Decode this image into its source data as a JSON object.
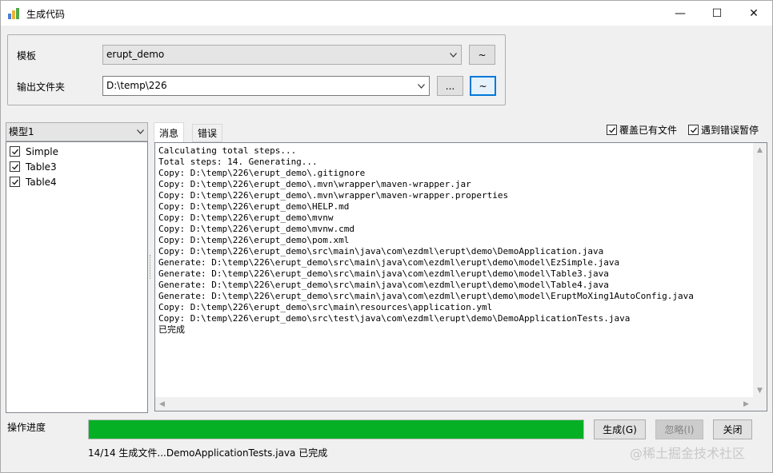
{
  "window": {
    "title": "生成代码",
    "min_glyph": "—",
    "max_glyph": "☐",
    "close_glyph": "✕"
  },
  "settings": {
    "template_label": "模板",
    "template_value": "erupt_demo",
    "template_btn": "~",
    "output_label": "输出文件夹",
    "output_value": "D:\\temp\\226",
    "browse_btn": "...",
    "output_btn": "~"
  },
  "model": {
    "selected": "模型1",
    "items": [
      {
        "label": "Simple",
        "checked": true
      },
      {
        "label": "Table3",
        "checked": true
      },
      {
        "label": "Table4",
        "checked": true
      }
    ]
  },
  "tabs": [
    {
      "label": "消息",
      "active": true
    },
    {
      "label": "错误",
      "active": false
    }
  ],
  "options": {
    "overwrite_label": "覆盖已有文件",
    "overwrite_checked": true,
    "pause_on_error_label": "遇到错误暂停",
    "pause_on_error_checked": true
  },
  "log": {
    "lines": [
      "Calculating total steps...",
      "Total steps: 14. Generating...",
      "Copy: D:\\temp\\226\\erupt_demo\\.gitignore",
      "Copy: D:\\temp\\226\\erupt_demo\\.mvn\\wrapper\\maven-wrapper.jar",
      "Copy: D:\\temp\\226\\erupt_demo\\.mvn\\wrapper\\maven-wrapper.properties",
      "Copy: D:\\temp\\226\\erupt_demo\\HELP.md",
      "Copy: D:\\temp\\226\\erupt_demo\\mvnw",
      "Copy: D:\\temp\\226\\erupt_demo\\mvnw.cmd",
      "Copy: D:\\temp\\226\\erupt_demo\\pom.xml",
      "Copy: D:\\temp\\226\\erupt_demo\\src\\main\\java\\com\\ezdml\\erupt\\demo\\DemoApplication.java",
      "Generate: D:\\temp\\226\\erupt_demo\\src\\main\\java\\com\\ezdml\\erupt\\demo\\model\\EzSimple.java",
      "Generate: D:\\temp\\226\\erupt_demo\\src\\main\\java\\com\\ezdml\\erupt\\demo\\model\\Table3.java",
      "Generate: D:\\temp\\226\\erupt_demo\\src\\main\\java\\com\\ezdml\\erupt\\demo\\model\\Table4.java",
      "Generate: D:\\temp\\226\\erupt_demo\\src\\main\\java\\com\\ezdml\\erupt\\demo\\model\\EruptMoXing1AutoConfig.java",
      "Copy: D:\\temp\\226\\erupt_demo\\src\\main\\resources\\application.yml",
      "Copy: D:\\temp\\226\\erupt_demo\\src\\test\\java\\com\\ezdml\\erupt\\demo\\DemoApplicationTests.java",
      "已完成"
    ]
  },
  "progress": {
    "label": "操作进度",
    "fraction": 1.0,
    "fill_color": "#06b025",
    "status_text": "14/14 生成文件...DemoApplicationTests.java 已完成"
  },
  "buttons": {
    "generate": "生成(G)",
    "ignore": "忽略(I)",
    "close": "关闭"
  },
  "watermark": "@稀土掘金技术社区",
  "icons": {
    "app": "app-icon",
    "check": "check-icon",
    "dropdown": "chevron-down-icon"
  }
}
